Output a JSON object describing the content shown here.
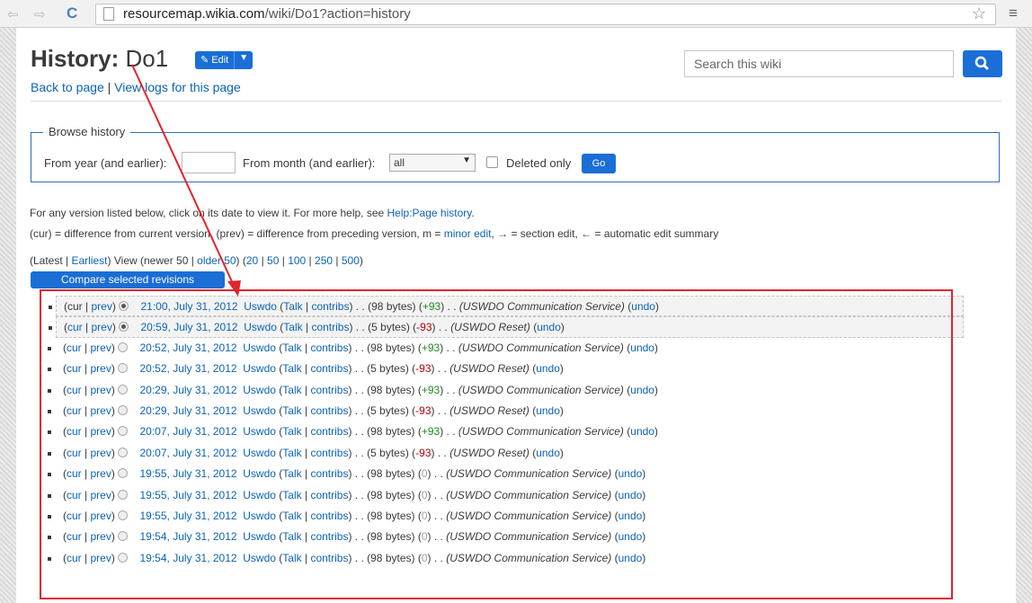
{
  "browser": {
    "url_host": "resourcemap.wikia.com",
    "url_path": "/wiki/Do1?action=history"
  },
  "header": {
    "title_bold": "History:",
    "title_page": "Do1",
    "edit_label": "Edit",
    "back_link": "Back to page",
    "logs_link": "View logs for this page",
    "search_placeholder": "Search this wiki"
  },
  "browse": {
    "legend": "Browse history",
    "year_label": "From year (and earlier):",
    "month_label": "From month (and earlier):",
    "month_value": "all",
    "deleted_label": "Deleted only",
    "go_label": "Go"
  },
  "info": {
    "line1_text": "For any version listed below, click on its date to view it. For more help, see ",
    "line1_link": "Help:Page history",
    "line2_a": "(cur) = difference from current version, (prev) = difference from preceding version, m = ",
    "line2_minor": "minor edit",
    "line2_b": ", → = section edit, ← = automatic edit summary"
  },
  "paging": {
    "latest": "Latest",
    "earliest": "Earliest",
    "newer": "newer 50",
    "older": "older 50",
    "view": "View",
    "limits": [
      "20",
      "50",
      "100",
      "250",
      "500"
    ]
  },
  "compare_label": "Compare selected revisions",
  "history": [
    {
      "cur_link": false,
      "prev_link": true,
      "radio": "on",
      "date": "21:00, July 31, 2012",
      "user": "Uswdo",
      "size": "(98 bytes)",
      "diff": "+93",
      "diff_kind": "pos",
      "comment": "(USWDO Communication Service)"
    },
    {
      "cur_link": true,
      "prev_link": true,
      "radio": "on",
      "date": "20:59, July 31, 2012",
      "user": "Uswdo",
      "size": "(5 bytes)",
      "diff": "-93",
      "diff_kind": "neg",
      "comment": "(USWDO Reset)"
    },
    {
      "cur_link": true,
      "prev_link": true,
      "radio": "off",
      "date": "20:52, July 31, 2012",
      "user": "Uswdo",
      "size": "(98 bytes)",
      "diff": "+93",
      "diff_kind": "pos",
      "comment": "(USWDO Communication Service)"
    },
    {
      "cur_link": true,
      "prev_link": true,
      "radio": "off",
      "date": "20:52, July 31, 2012",
      "user": "Uswdo",
      "size": "(5 bytes)",
      "diff": "-93",
      "diff_kind": "neg",
      "comment": "(USWDO Reset)"
    },
    {
      "cur_link": true,
      "prev_link": true,
      "radio": "off",
      "date": "20:29, July 31, 2012",
      "user": "Uswdo",
      "size": "(98 bytes)",
      "diff": "+93",
      "diff_kind": "pos",
      "comment": "(USWDO Communication Service)"
    },
    {
      "cur_link": true,
      "prev_link": true,
      "radio": "off",
      "date": "20:29, July 31, 2012",
      "user": "Uswdo",
      "size": "(5 bytes)",
      "diff": "-93",
      "diff_kind": "neg",
      "comment": "(USWDO Reset)"
    },
    {
      "cur_link": true,
      "prev_link": true,
      "radio": "off",
      "date": "20:07, July 31, 2012",
      "user": "Uswdo",
      "size": "(98 bytes)",
      "diff": "+93",
      "diff_kind": "pos",
      "comment": "(USWDO Communication Service)"
    },
    {
      "cur_link": true,
      "prev_link": true,
      "radio": "off",
      "date": "20:07, July 31, 2012",
      "user": "Uswdo",
      "size": "(5 bytes)",
      "diff": "-93",
      "diff_kind": "neg",
      "comment": "(USWDO Reset)"
    },
    {
      "cur_link": true,
      "prev_link": true,
      "radio": "off",
      "date": "19:55, July 31, 2012",
      "user": "Uswdo",
      "size": "(98 bytes)",
      "diff": "0",
      "diff_kind": "zero",
      "comment": "(USWDO Communication Service)"
    },
    {
      "cur_link": true,
      "prev_link": true,
      "radio": "off",
      "date": "19:55, July 31, 2012",
      "user": "Uswdo",
      "size": "(98 bytes)",
      "diff": "0",
      "diff_kind": "zero",
      "comment": "(USWDO Communication Service)"
    },
    {
      "cur_link": true,
      "prev_link": true,
      "radio": "off",
      "date": "19:55, July 31, 2012",
      "user": "Uswdo",
      "size": "(98 bytes)",
      "diff": "0",
      "diff_kind": "zero",
      "comment": "(USWDO Communication Service)"
    },
    {
      "cur_link": true,
      "prev_link": true,
      "radio": "off",
      "date": "19:54, July 31, 2012",
      "user": "Uswdo",
      "size": "(98 bytes)",
      "diff": "0",
      "diff_kind": "zero",
      "comment": "(USWDO Communication Service)"
    },
    {
      "cur_link": true,
      "prev_link": true,
      "radio": "off",
      "date": "19:54, July 31, 2012",
      "user": "Uswdo",
      "size": "(98 bytes)",
      "diff": "0",
      "diff_kind": "zero",
      "comment": "(USWDO Communication Service)"
    }
  ],
  "labels": {
    "cur": "cur",
    "prev": "prev",
    "talk": "Talk",
    "contribs": "contribs",
    "undo": "undo"
  },
  "colors": {
    "link": "#0b63b6",
    "button": "#1a6ed6",
    "positive_diff": "#1f8b1f",
    "negative_diff": "#b30000",
    "annotation": "#e3242b"
  }
}
